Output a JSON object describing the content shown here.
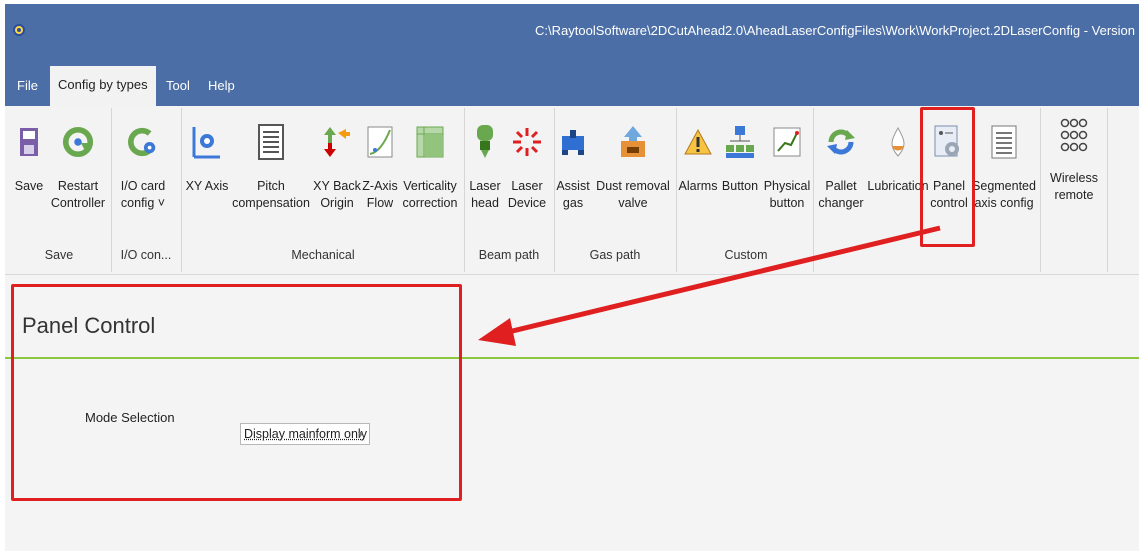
{
  "window": {
    "title": "C:\\RaytoolSoftware\\2DCutAhead2.0\\AheadLaserConfigFiles\\Work\\WorkProject.2DLaserConfig - Version",
    "app_icon": "gear-icon"
  },
  "menu": {
    "items": [
      {
        "label": "File"
      },
      {
        "label": "Config by types",
        "active": true
      },
      {
        "label": "Tool"
      },
      {
        "label": "Help"
      }
    ]
  },
  "ribbon": {
    "buttons": {
      "save": {
        "label": "Save",
        "icon": "floppy-disk-icon"
      },
      "restart": {
        "label": "Restart\nController",
        "icon": "restart-icon"
      },
      "io_card": {
        "label": "I/O card\nconfig ˅",
        "icon": "io-card-gear-icon"
      },
      "xy_axis": {
        "label": "XY Axis",
        "icon": "axis-gear-icon"
      },
      "pitch": {
        "label": "Pitch\ncompensation",
        "icon": "document-lines-icon"
      },
      "xy_back": {
        "label": "XY Back\nOrigin",
        "icon": "arrows-origin-icon"
      },
      "z_axis": {
        "label": "Z-Axis\nFlow",
        "icon": "curve-chart-icon"
      },
      "verticality": {
        "label": "Verticality\ncorrection",
        "icon": "grid-icon"
      },
      "laser_head": {
        "label": "Laser\nhead",
        "icon": "laser-head-icon"
      },
      "laser_device": {
        "label": "Laser\nDevice",
        "icon": "laser-burst-icon"
      },
      "assist_gas": {
        "label": "Assist\ngas",
        "icon": "gas-valve-icon"
      },
      "dust_removal": {
        "label": "Dust removal\nvalve",
        "icon": "dust-box-icon"
      },
      "alarms": {
        "label": "Alarms",
        "icon": "warning-icon"
      },
      "button": {
        "label": "Button",
        "icon": "hierarchy-icon"
      },
      "physical_button": {
        "label": "Physical\nbutton",
        "icon": "line-graph-icon"
      },
      "pallet": {
        "label": "Pallet\nchanger",
        "icon": "cycle-arrows-icon"
      },
      "lubrication": {
        "label": "Lubrication",
        "icon": "oil-drop-icon"
      },
      "panel_control": {
        "label": "Panel\ncontrol",
        "icon": "panel-gears-icon"
      },
      "segmented": {
        "label": "Segmented\naxis config",
        "icon": "segmented-list-icon"
      },
      "wireless": {
        "label": "Wireless\nremote",
        "icon": "remote-dots-icon"
      }
    },
    "groups": {
      "save": "Save",
      "io": "I/O con...",
      "mechanical": "Mechanical",
      "beam": "Beam path",
      "gas": "Gas path",
      "custom": "Custom"
    }
  },
  "panel": {
    "title": "Panel Control",
    "mode_label": "Mode Selection",
    "mode_value": "Display mainform only"
  },
  "colors": {
    "titlebar": "#4a6ea5",
    "accent_line": "#8dc63f",
    "annotation": "#e02020"
  }
}
